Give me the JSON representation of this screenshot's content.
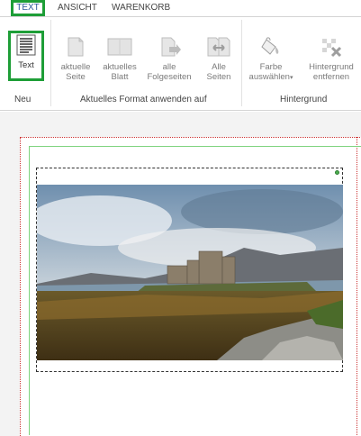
{
  "tabs": {
    "text": "TEXT",
    "ansicht": "ANSICHT",
    "warenkorb": "WARENKORB"
  },
  "ribbon": {
    "text_button": "Text",
    "current_page_l1": "aktuelle",
    "current_page_l2": "Seite",
    "current_sheet_l1": "aktuelles",
    "current_sheet_l2": "Blatt",
    "all_following_l1": "alle",
    "all_following_l2": "Folgeseiten",
    "all_pages_l1": "Alle",
    "all_pages_l2": "Seiten",
    "choose_color_l1": "Farbe",
    "choose_color_l2": "auswählen",
    "remove_bg_l1": "Hintergrund",
    "remove_bg_l2": "entfernen",
    "group_new": "Neu",
    "group_apply_format": "Aktuelles Format anwenden auf",
    "group_background": "Hintergrund"
  },
  "colors": {
    "highlight": "#1e9e37",
    "accent": "#2b579a",
    "margin_guide": "#cc3333"
  },
  "image": {
    "subject": "castle-on-island-landscape-photo"
  }
}
